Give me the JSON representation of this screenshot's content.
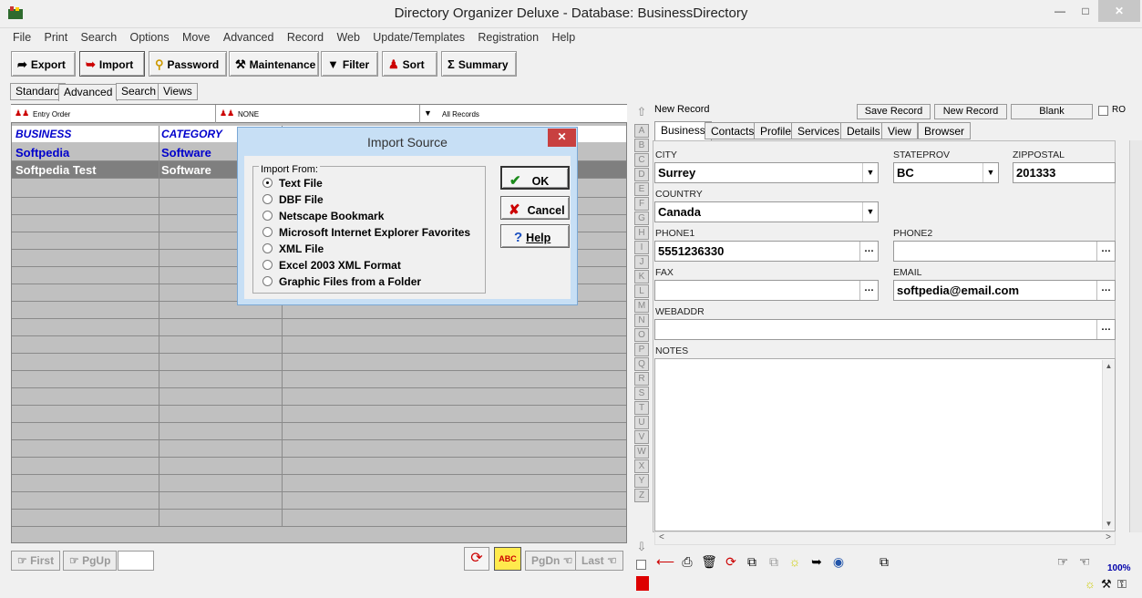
{
  "window": {
    "title": "Directory Organizer Deluxe - Database: BusinessDirectory"
  },
  "menu": [
    "File",
    "Print",
    "Search",
    "Options",
    "Move",
    "Advanced",
    "Record",
    "Web",
    "Update/Templates",
    "Registration",
    "Help"
  ],
  "toolbar": {
    "export": "Export",
    "import": "Import",
    "password": "Password",
    "maintenance": "Maintenance",
    "filter": "Filter",
    "sort": "Sort",
    "summary": "Summary"
  },
  "view_tabs": [
    "Standard",
    "Advanced",
    "Search",
    "Views"
  ],
  "sortbar": {
    "order": "Entry Order",
    "group": "NONE",
    "records": "All Records"
  },
  "grid": {
    "headers": [
      "BUSINESS",
      "CATEGORY"
    ],
    "rows": [
      {
        "business": "Softpedia",
        "category": "Software"
      },
      {
        "business": "Softpedia Test",
        "category": "Software"
      }
    ]
  },
  "nav": {
    "first": "First",
    "pgup": "PgUp",
    "pgdn": "PgDn",
    "last": "Last"
  },
  "dialog": {
    "title": "Import Source",
    "group_label": "Import From:",
    "options": [
      "Text File",
      "DBF File",
      "Netscape Bookmark",
      "Microsoft Internet Explorer Favorites",
      "XML File",
      "Excel 2003 XML Format",
      "Graphic Files from a Folder"
    ],
    "selected": "Text File",
    "ok": "OK",
    "cancel": "Cancel",
    "help": "Help"
  },
  "record": {
    "status": "New Record",
    "save": "Save Record",
    "new": "New Record",
    "blank": "Blank",
    "ro": "RO",
    "tabs": [
      "Business",
      "Contacts",
      "Profile",
      "Services",
      "Details",
      "View",
      "Browser"
    ],
    "active_tab": "Business"
  },
  "alpha": [
    "A",
    "B",
    "C",
    "D",
    "E",
    "F",
    "G",
    "H",
    "I",
    "J",
    "K",
    "L",
    "M",
    "N",
    "O",
    "P",
    "Q",
    "R",
    "S",
    "T",
    "U",
    "V",
    "W",
    "X",
    "Y",
    "Z"
  ],
  "fields": {
    "city_label": "CITY",
    "city": "Surrey",
    "state_label": "STATEPROV",
    "state": "BC",
    "zip_label": "ZIPPOSTAL",
    "zip": "201333",
    "country_label": "COUNTRY",
    "country": "Canada",
    "phone1_label": "PHONE1",
    "phone1": "5551236330",
    "phone2_label": "PHONE2",
    "phone2": "",
    "fax_label": "FAX",
    "fax": "",
    "email_label": "EMAIL",
    "email": "softpedia@email.com",
    "web_label": "WEBADDR",
    "web": "",
    "notes_label": "NOTES"
  },
  "zoom": "100%",
  "colors": {
    "accent": "#0000cc",
    "dialog_frame": "#c7dff5",
    "close_red": "#c84040"
  }
}
